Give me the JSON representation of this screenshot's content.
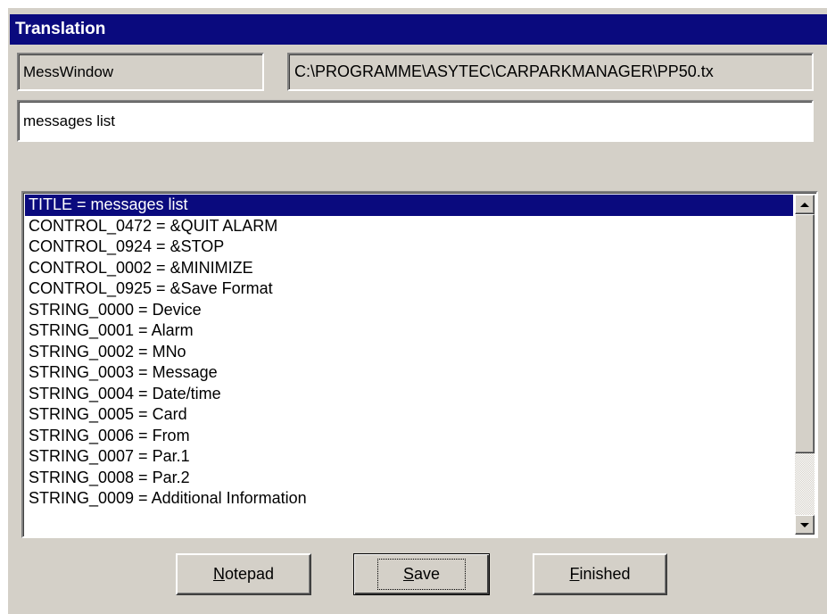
{
  "window": {
    "title": "Translation"
  },
  "fields": {
    "name": "MessWindow",
    "path": "C:\\PROGRAMME\\ASYTEC\\CARPARKMANAGER\\PP50.tx",
    "title_value": "messages list"
  },
  "list": {
    "items": [
      "TITLE = messages list",
      "CONTROL_0472 = &QUIT ALARM",
      "CONTROL_0924 = &STOP",
      "CONTROL_0002 = &MINIMIZE",
      "CONTROL_0925 = &Save Format",
      "STRING_0000 = Device",
      "STRING_0001 = Alarm",
      "STRING_0002 = MNo",
      "STRING_0003 = Message",
      "STRING_0004 = Date/time",
      "STRING_0005 = Card",
      "STRING_0006 = From",
      "STRING_0007 = Par.1",
      "STRING_0008 = Par.2",
      "STRING_0009 = Additional Information"
    ],
    "selected_index": 0
  },
  "buttons": {
    "notepad": {
      "accel": "N",
      "rest": "otepad"
    },
    "save": {
      "accel": "S",
      "rest": "ave"
    },
    "finished": {
      "accel": "F",
      "rest": "inished"
    }
  },
  "colors": {
    "selection": "#0a0a7e",
    "face": "#d4d0c8"
  }
}
